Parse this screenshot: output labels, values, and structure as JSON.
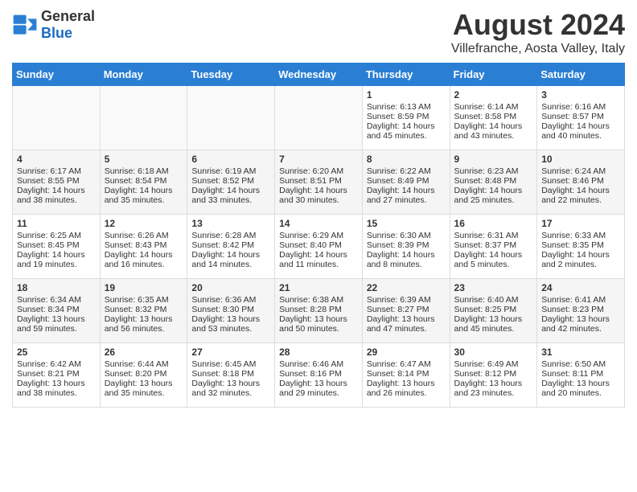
{
  "logo": {
    "general": "General",
    "blue": "Blue"
  },
  "title": "August 2024",
  "subtitle": "Villefranche, Aosta Valley, Italy",
  "days_of_week": [
    "Sunday",
    "Monday",
    "Tuesday",
    "Wednesday",
    "Thursday",
    "Friday",
    "Saturday"
  ],
  "weeks": [
    [
      {
        "day": "",
        "empty": true
      },
      {
        "day": "",
        "empty": true
      },
      {
        "day": "",
        "empty": true
      },
      {
        "day": "",
        "empty": true
      },
      {
        "day": "1",
        "sunrise": "6:13 AM",
        "sunset": "8:59 PM",
        "daylight": "14 hours and 45 minutes."
      },
      {
        "day": "2",
        "sunrise": "6:14 AM",
        "sunset": "8:58 PM",
        "daylight": "14 hours and 43 minutes."
      },
      {
        "day": "3",
        "sunrise": "6:16 AM",
        "sunset": "8:57 PM",
        "daylight": "14 hours and 40 minutes."
      }
    ],
    [
      {
        "day": "4",
        "sunrise": "6:17 AM",
        "sunset": "8:55 PM",
        "daylight": "14 hours and 38 minutes."
      },
      {
        "day": "5",
        "sunrise": "6:18 AM",
        "sunset": "8:54 PM",
        "daylight": "14 hours and 35 minutes."
      },
      {
        "day": "6",
        "sunrise": "6:19 AM",
        "sunset": "8:52 PM",
        "daylight": "14 hours and 33 minutes."
      },
      {
        "day": "7",
        "sunrise": "6:20 AM",
        "sunset": "8:51 PM",
        "daylight": "14 hours and 30 minutes."
      },
      {
        "day": "8",
        "sunrise": "6:22 AM",
        "sunset": "8:49 PM",
        "daylight": "14 hours and 27 minutes."
      },
      {
        "day": "9",
        "sunrise": "6:23 AM",
        "sunset": "8:48 PM",
        "daylight": "14 hours and 25 minutes."
      },
      {
        "day": "10",
        "sunrise": "6:24 AM",
        "sunset": "8:46 PM",
        "daylight": "14 hours and 22 minutes."
      }
    ],
    [
      {
        "day": "11",
        "sunrise": "6:25 AM",
        "sunset": "8:45 PM",
        "daylight": "14 hours and 19 minutes."
      },
      {
        "day": "12",
        "sunrise": "6:26 AM",
        "sunset": "8:43 PM",
        "daylight": "14 hours and 16 minutes."
      },
      {
        "day": "13",
        "sunrise": "6:28 AM",
        "sunset": "8:42 PM",
        "daylight": "14 hours and 14 minutes."
      },
      {
        "day": "14",
        "sunrise": "6:29 AM",
        "sunset": "8:40 PM",
        "daylight": "14 hours and 11 minutes."
      },
      {
        "day": "15",
        "sunrise": "6:30 AM",
        "sunset": "8:39 PM",
        "daylight": "14 hours and 8 minutes."
      },
      {
        "day": "16",
        "sunrise": "6:31 AM",
        "sunset": "8:37 PM",
        "daylight": "14 hours and 5 minutes."
      },
      {
        "day": "17",
        "sunrise": "6:33 AM",
        "sunset": "8:35 PM",
        "daylight": "14 hours and 2 minutes."
      }
    ],
    [
      {
        "day": "18",
        "sunrise": "6:34 AM",
        "sunset": "8:34 PM",
        "daylight": "13 hours and 59 minutes."
      },
      {
        "day": "19",
        "sunrise": "6:35 AM",
        "sunset": "8:32 PM",
        "daylight": "13 hours and 56 minutes."
      },
      {
        "day": "20",
        "sunrise": "6:36 AM",
        "sunset": "8:30 PM",
        "daylight": "13 hours and 53 minutes."
      },
      {
        "day": "21",
        "sunrise": "6:38 AM",
        "sunset": "8:28 PM",
        "daylight": "13 hours and 50 minutes."
      },
      {
        "day": "22",
        "sunrise": "6:39 AM",
        "sunset": "8:27 PM",
        "daylight": "13 hours and 47 minutes."
      },
      {
        "day": "23",
        "sunrise": "6:40 AM",
        "sunset": "8:25 PM",
        "daylight": "13 hours and 45 minutes."
      },
      {
        "day": "24",
        "sunrise": "6:41 AM",
        "sunset": "8:23 PM",
        "daylight": "13 hours and 42 minutes."
      }
    ],
    [
      {
        "day": "25",
        "sunrise": "6:42 AM",
        "sunset": "8:21 PM",
        "daylight": "13 hours and 38 minutes."
      },
      {
        "day": "26",
        "sunrise": "6:44 AM",
        "sunset": "8:20 PM",
        "daylight": "13 hours and 35 minutes."
      },
      {
        "day": "27",
        "sunrise": "6:45 AM",
        "sunset": "8:18 PM",
        "daylight": "13 hours and 32 minutes."
      },
      {
        "day": "28",
        "sunrise": "6:46 AM",
        "sunset": "8:16 PM",
        "daylight": "13 hours and 29 minutes."
      },
      {
        "day": "29",
        "sunrise": "6:47 AM",
        "sunset": "8:14 PM",
        "daylight": "13 hours and 26 minutes."
      },
      {
        "day": "30",
        "sunrise": "6:49 AM",
        "sunset": "8:12 PM",
        "daylight": "13 hours and 23 minutes."
      },
      {
        "day": "31",
        "sunrise": "6:50 AM",
        "sunset": "8:11 PM",
        "daylight": "13 hours and 20 minutes."
      }
    ]
  ]
}
